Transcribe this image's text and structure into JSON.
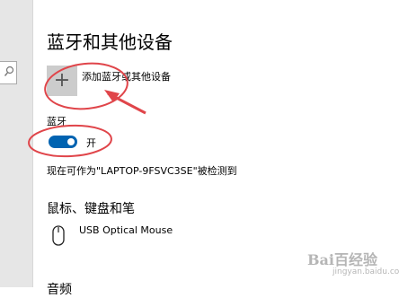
{
  "page": {
    "title": "蓝牙和其他设备"
  },
  "add_device": {
    "icon": "plus-icon",
    "label": "添加蓝牙或其他设备"
  },
  "bluetooth": {
    "label": "蓝牙",
    "state_text": "开",
    "on": true,
    "accent_color": "#0063b1"
  },
  "discoverable": {
    "text": "现在可作为\"LAPTOP-9FSVC3SE\"被检测到"
  },
  "mouse_section": {
    "title": "鼠标、键盘和笔",
    "devices": [
      {
        "icon": "mouse-icon",
        "name": "USB Optical Mouse"
      }
    ]
  },
  "next_section": {
    "title": "音频"
  },
  "sidebar": {
    "search_icon": "search-icon"
  },
  "annotation": {
    "color": "#e0454a"
  },
  "watermark": {
    "brand": "Bai百经验",
    "sub": "jingyan.baidu.com"
  }
}
